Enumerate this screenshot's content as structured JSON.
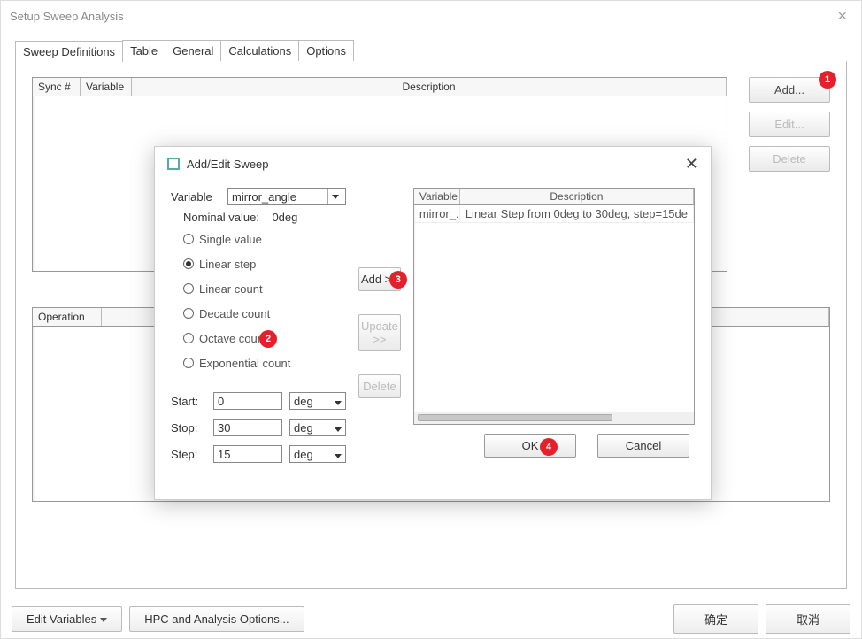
{
  "window": {
    "title": "Setup Sweep Analysis"
  },
  "tabs": [
    "Sweep Definitions",
    "Table",
    "General",
    "Calculations",
    "Options"
  ],
  "defs": {
    "cols": {
      "sync": "Sync #",
      "var": "Variable",
      "desc": "Description"
    },
    "buttons": {
      "add": "Add...",
      "edit": "Edit...",
      "delete": "Delete"
    }
  },
  "op": {
    "col": "Operation"
  },
  "footer": {
    "editvars": "Edit Variables",
    "hpc": "HPC and Analysis Options...",
    "ok": "确定",
    "cancel": "取消"
  },
  "dialog": {
    "title": "Add/Edit Sweep",
    "variable_label": "Variable",
    "variable_value": "mirror_angle",
    "nominal_label": "Nominal value:",
    "nominal_value": "0deg",
    "radios": [
      "Single value",
      "Linear step",
      "Linear count",
      "Decade count",
      "Octave count",
      "Exponential count"
    ],
    "radio_selected": 1,
    "start_label": "Start:",
    "start_val": "0",
    "stop_label": "Stop:",
    "stop_val": "30",
    "step_label": "Step:",
    "step_val": "15",
    "unit": "deg",
    "mid": {
      "add": "Add >>",
      "update": "Update >>",
      "delete": "Delete"
    },
    "table": {
      "cols": {
        "var": "Variable",
        "desc": "Description"
      },
      "row": {
        "var": "mirror_...",
        "desc": "Linear Step from 0deg to 30deg, step=15de"
      }
    },
    "ok": "OK",
    "cancel": "Cancel"
  },
  "badges": {
    "b1": "1",
    "b2": "2",
    "b3": "3",
    "b4": "4"
  }
}
